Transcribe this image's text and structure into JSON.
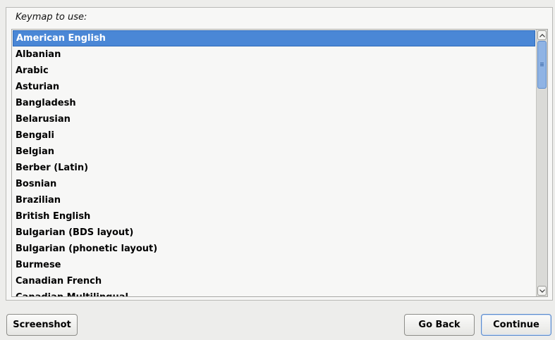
{
  "prompt": "Keymap to use:",
  "keymaps": [
    "American English",
    "Albanian",
    "Arabic",
    "Asturian",
    "Bangladesh",
    "Belarusian",
    "Bengali",
    "Belgian",
    "Berber (Latin)",
    "Bosnian",
    "Brazilian",
    "British English",
    "Bulgarian (BDS layout)",
    "Bulgarian (phonetic layout)",
    "Burmese",
    "Canadian French",
    "Canadian Multilingual"
  ],
  "selected_keymap": "American English",
  "colors": {
    "selection": "#4a87d6",
    "scroll_thumb": "#8fb3e4",
    "background": "#ededeb"
  },
  "buttons": {
    "screenshot": "Screenshot",
    "go_back": "Go Back",
    "continue": "Continue"
  }
}
